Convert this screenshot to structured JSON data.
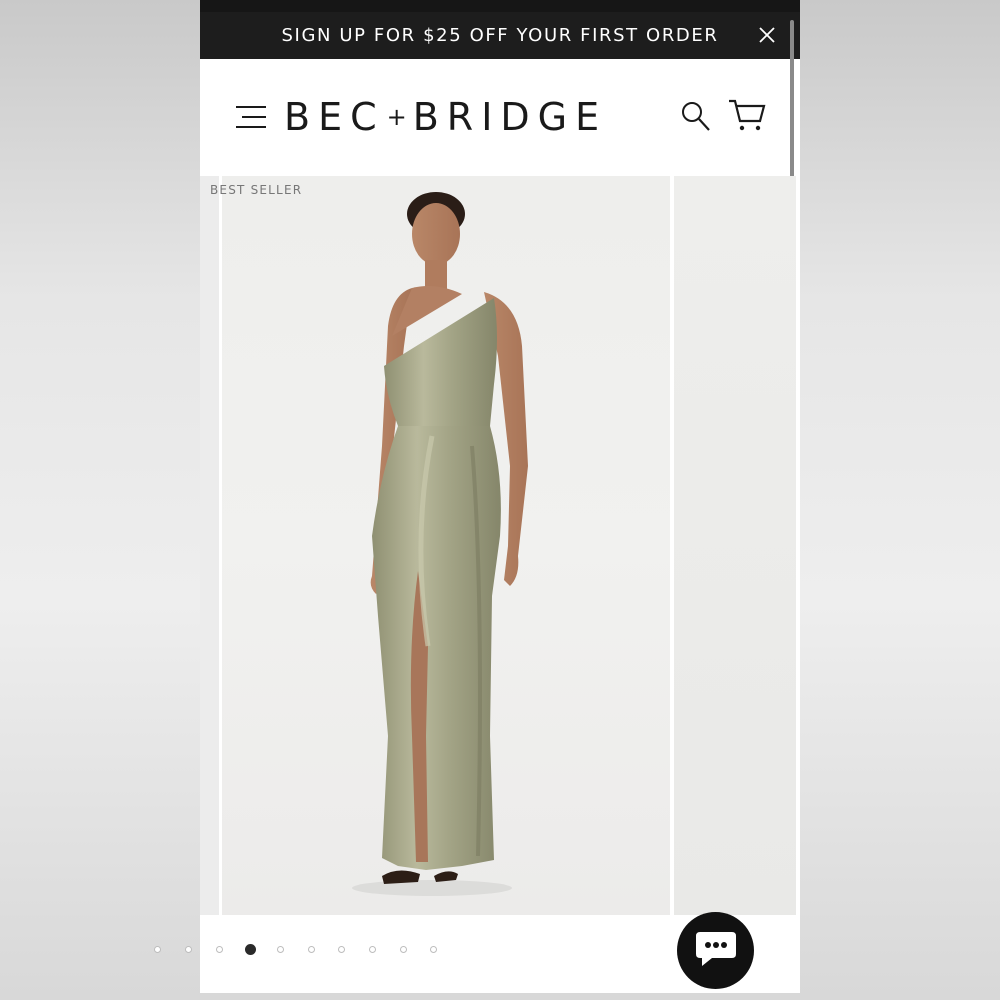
{
  "promo_bar": {
    "text": "SIGN UP FOR $25 OFF YOUR FIRST ORDER",
    "close_icon": "close-icon"
  },
  "header": {
    "logo_left": "BEC",
    "logo_plus": "+",
    "logo_right": "BRIDGE",
    "menu_icon": "hamburger-menu-icon",
    "search_icon": "search-icon",
    "cart_icon": "cart-icon"
  },
  "product_gallery": {
    "badge": "BEST SELLER",
    "image_alt": "Model wearing olive one-shoulder satin maxi dress with side split",
    "dress_color": "#a8a98a",
    "slide_count": 10,
    "active_slide": 4
  },
  "chat": {
    "icon": "chat-bubble-icon"
  },
  "colors": {
    "promo_bg": "#1d1d1d",
    "text": "#1a1a1a",
    "accent": "#111111"
  }
}
